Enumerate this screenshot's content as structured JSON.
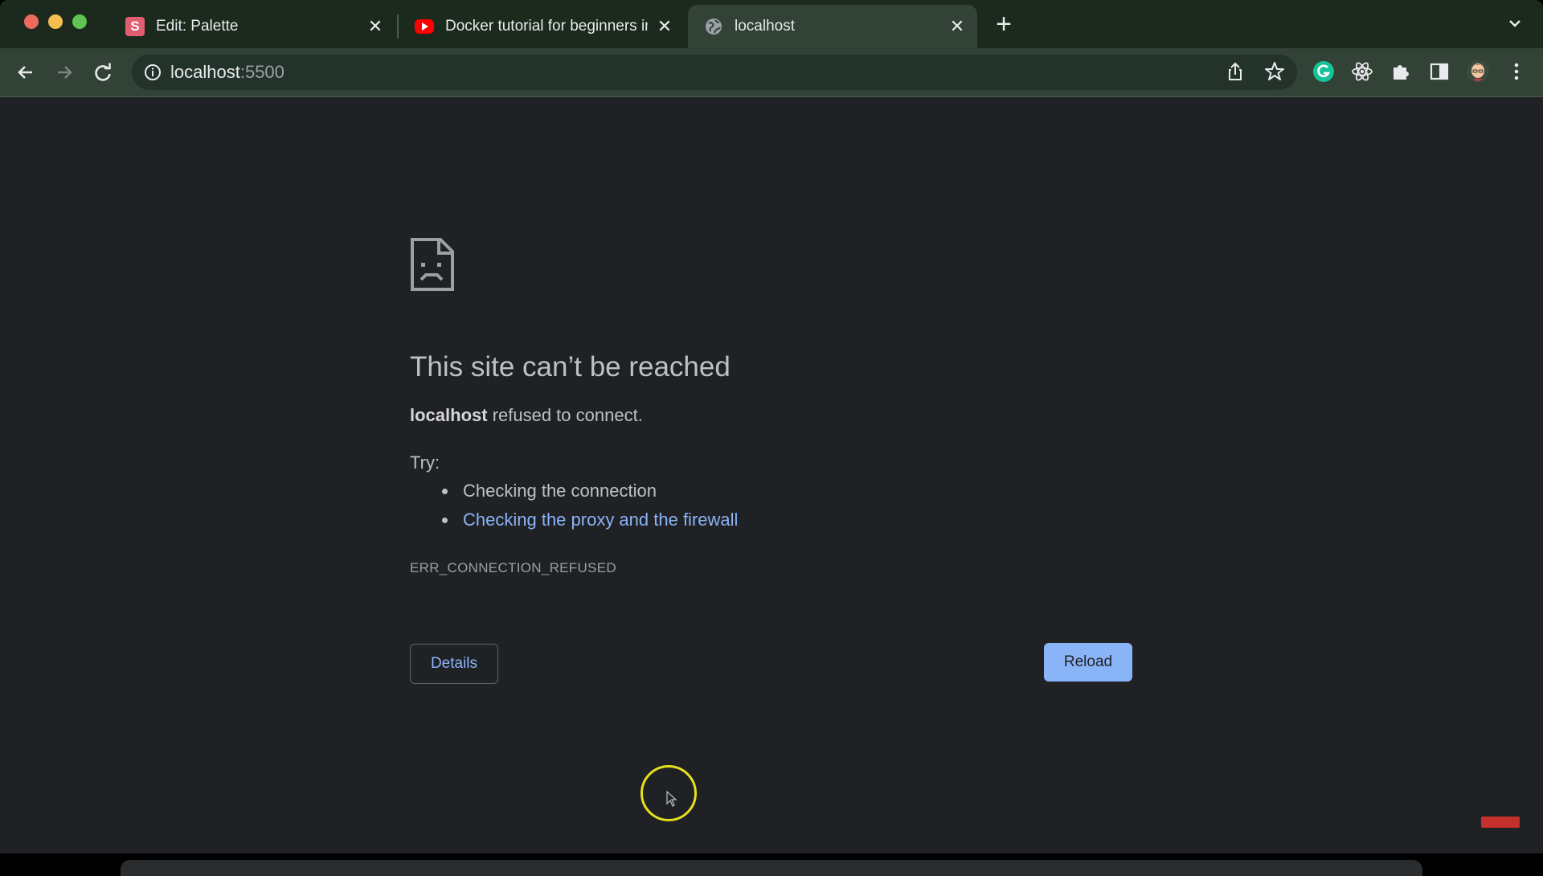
{
  "browser": {
    "tabs": [
      {
        "title": "Edit: Palette",
        "favicon": "s-logo-icon",
        "active": false
      },
      {
        "title": "Docker tutorial for beginners in",
        "favicon": "youtube-icon",
        "active": false
      },
      {
        "title": "localhost",
        "favicon": "globe-icon",
        "active": true
      }
    ],
    "address": {
      "host": "localhost",
      "port": ":5500"
    }
  },
  "error_page": {
    "headline": "This site can’t be reached",
    "host_bold": "localhost",
    "description_rest": " refused to connect.",
    "try_label": "Try:",
    "suggestions": [
      "Checking the connection",
      "Checking the proxy and the firewall"
    ],
    "error_code": "ERR_CONNECTION_REFUSED",
    "details_label": "Details",
    "reload_label": "Reload"
  },
  "colors": {
    "tabstrip": "#1c2a1e",
    "toolbar": "#324236",
    "page_bg": "#202124",
    "link": "#8ab4f8",
    "reload_bg": "#8ab4f8",
    "cursor_ring": "#e5e01f"
  }
}
